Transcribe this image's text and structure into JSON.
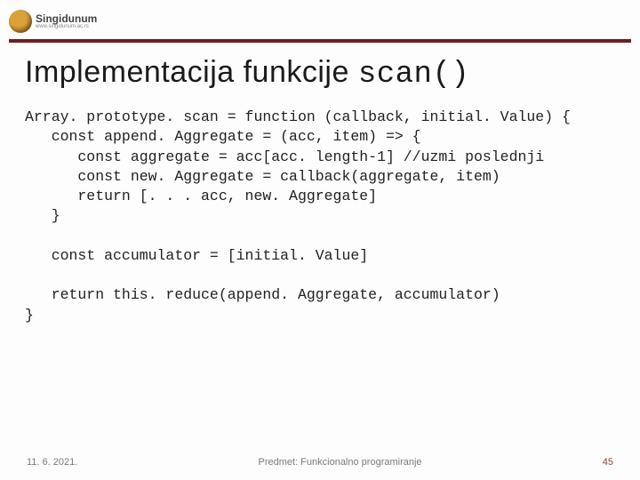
{
  "logo": {
    "name": "Singidunum",
    "sub": "www.singidunum.ac.rs"
  },
  "title_plain": "Implementacija funkcije ",
  "title_mono": "scan()",
  "code_lines": [
    "Array. prototype. scan = function (callback, initial. Value) {",
    "   const append. Aggregate = (acc, item) => {",
    "      const aggregate = acc[acc. length-1] //uzmi poslednji",
    "      const new. Aggregate = callback(aggregate, item)",
    "      return [. . . acc, new. Aggregate]",
    "   }",
    "",
    "   const accumulator = [initial. Value]",
    "",
    "   return this. reduce(append. Aggregate, accumulator)",
    "}"
  ],
  "footer": {
    "date": "11. 6. 2021.",
    "subject": "Predmet: Funkcionalno programiranje",
    "page": "45"
  }
}
